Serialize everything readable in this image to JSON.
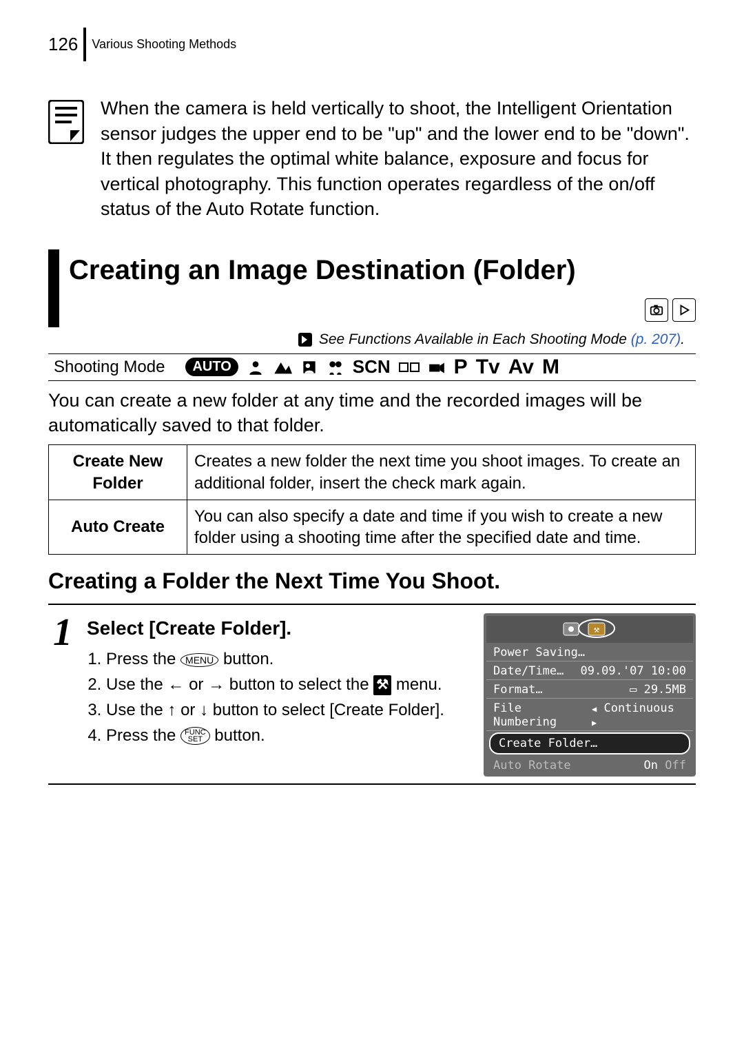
{
  "header": {
    "page_number": "126",
    "section_title": "Various Shooting Methods"
  },
  "note": {
    "text": "When the camera is held vertically to shoot, the Intelligent Orientation sensor judges the upper end to be \"up\" and the lower end to be \"down\". It then regulates the optimal white balance, exposure and focus for vertical photography. This function operates regardless of the on/off status of the Auto Rotate function."
  },
  "heading_main": "Creating an Image Destination (Folder)",
  "see_ref": {
    "prefix": "See ",
    "title": "Functions Available in Each Shooting Mode",
    "page": "(p. 207)"
  },
  "shooting_mode_label": "Shooting Mode",
  "shooting_mode_icons": {
    "auto": "AUTO",
    "scn": "SCN",
    "p": "P",
    "tv": "Tv",
    "av": "Av",
    "m": "M"
  },
  "body": "You can create a new folder at any time and the recorded images will be automatically saved to that folder.",
  "options": [
    {
      "label": "Create New Folder",
      "desc": "Creates a new folder the next time you shoot images. To create an additional folder, insert the check mark again."
    },
    {
      "label": "Auto Create",
      "desc": "You can also specify a date and time if you wish to create a new folder using a shooting time after the specified date and time."
    }
  ],
  "subhead": "Creating a Folder the Next Time You Shoot.",
  "step": {
    "number": "1",
    "title": "Select [Create Folder].",
    "items": {
      "i1a": "Press the ",
      "i1b": " button.",
      "menu_label": "MENU",
      "i2a": "Use the  ",
      "i2b": "  or  ",
      "i2c": "  button to select the ",
      "i2d": " menu.",
      "tool_label": "⚒",
      "i3a": "Use the  ",
      "i3b": "  or  ",
      "i3c": "  button to select [Create Folder].",
      "i4a": "Press the ",
      "i4b": " button.",
      "func_top": "FUNC",
      "func_bot": "SET"
    }
  },
  "lcd": {
    "rows": [
      {
        "label": "Power Saving…",
        "value": ""
      },
      {
        "label": "Date/Time…",
        "value": "09.09.'07 10:00"
      },
      {
        "label": "Format…",
        "value": "29.5MB"
      },
      {
        "label": "File Numbering",
        "value": "Continuous"
      },
      {
        "label": "Create Folder…",
        "value": "",
        "highlight": true
      },
      {
        "label": "Auto Rotate",
        "value_on": "On",
        "value_off": "Off"
      }
    ]
  }
}
